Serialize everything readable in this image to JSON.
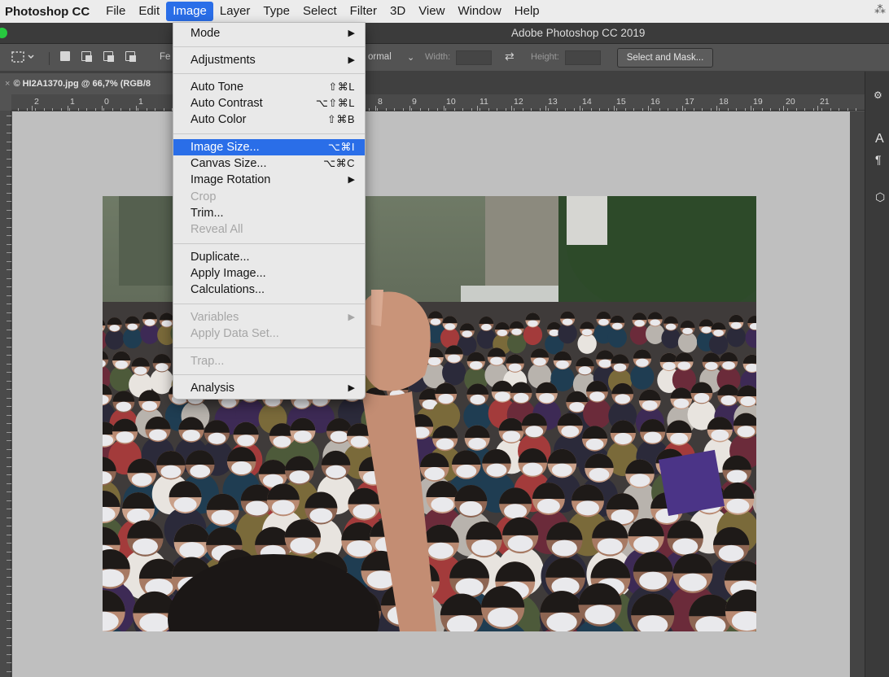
{
  "menubar": {
    "app_name": "Photoshop CC",
    "items": [
      "File",
      "Edit",
      "Image",
      "Layer",
      "Type",
      "Select",
      "Filter",
      "3D",
      "View",
      "Window",
      "Help"
    ],
    "active_item": "Image"
  },
  "window": {
    "title": "Adobe Photoshop CC 2019"
  },
  "options_bar": {
    "feather_label": "Fe",
    "style_value": "ormal",
    "width_label": "Width:",
    "height_label": "Height:",
    "select_mask_button": "Select and Mask..."
  },
  "document": {
    "tab_label": "© HI2A1370.jpg @ 66,7% (RGB/8"
  },
  "ruler": {
    "labels": [
      "2",
      "1",
      "0",
      "1",
      "8",
      "9",
      "10",
      "11",
      "12",
      "13",
      "14",
      "15",
      "16",
      "17",
      "18",
      "19",
      "20",
      "21"
    ]
  },
  "image_menu": {
    "mode": "Mode",
    "adjustments": "Adjustments",
    "auto_tone": "Auto Tone",
    "auto_tone_sc": "⇧⌘L",
    "auto_contrast": "Auto Contrast",
    "auto_contrast_sc": "⌥⇧⌘L",
    "auto_color": "Auto Color",
    "auto_color_sc": "⇧⌘B",
    "image_size": "Image Size...",
    "image_size_sc": "⌥⌘I",
    "canvas_size": "Canvas Size...",
    "canvas_size_sc": "⌥⌘C",
    "image_rotation": "Image Rotation",
    "crop": "Crop",
    "trim": "Trim...",
    "reveal_all": "Reveal All",
    "duplicate": "Duplicate...",
    "apply_image": "Apply Image...",
    "calculations": "Calculations...",
    "variables": "Variables",
    "apply_data_set": "Apply Data Set...",
    "trap": "Trap...",
    "analysis": "Analysis",
    "highlighted": "Image Size..."
  },
  "dock": {
    "char_label": "A",
    "para_label": "¶"
  },
  "colors": {
    "menu_highlight": "#2a6ee8",
    "ui_dark": "#535353",
    "pasteboard": "#bfbfbf"
  }
}
